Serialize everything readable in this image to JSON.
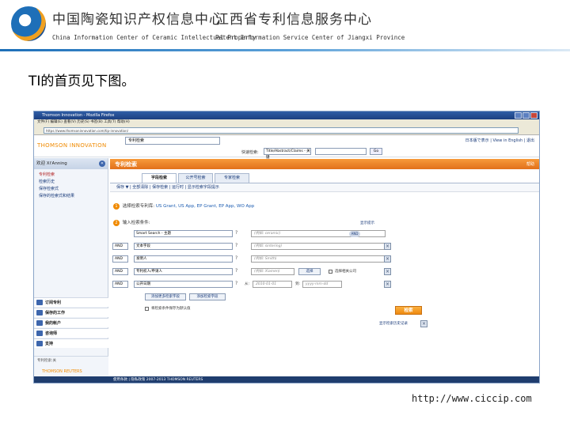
{
  "slide": {
    "header": {
      "left_cn": "中国陶瓷知识产权信息中心",
      "left_en": "China Information Center of Ceramic Intellectual Property",
      "right_cn": "江西省专利信息服务中心",
      "right_en": "Patent Information Service Center of Jiangxi Province"
    },
    "intro": "TI的首页见下图。",
    "footer_url": "http://www.ciccip.com"
  },
  "browser": {
    "title": "Thomson Innovation - Mozilla Firefox",
    "menu": "文件(F)  编辑(E)  查看(V)  历史(S)  书签(B)  工具(T)  帮助(H)",
    "address": "https://www.thomsoninnovation.com/tip-innovation/",
    "app": {
      "logo": "THOMSON INNOVATION",
      "db_select": "专利检索",
      "top_links": "日本版で表示 | View in English | 退出",
      "quick_search_label": "快速检索:",
      "quick_search_field": "Title/Abstract/Claims - 关键",
      "quick_search_go": "Go"
    },
    "sidebar": {
      "welcome": "欢迎 Xi'Anning",
      "collapse_icon": "«",
      "items": [
        {
          "label": "检索"
        },
        {
          "label": "专利检索"
        },
        {
          "label": "检索历史"
        },
        {
          "label": "保存检索式"
        },
        {
          "label": "保存的检索式和结果"
        }
      ],
      "panels": [
        {
          "label": "订阅专利"
        },
        {
          "label": "保存的工作"
        },
        {
          "label": "我的帐户"
        },
        {
          "label": "咨询师"
        },
        {
          "label": "支持"
        }
      ],
      "footer_label": "专利检索:关",
      "footer_logo": "THOMSON REUTERS"
    },
    "main": {
      "panel_title": "专利检索",
      "help": "帮助",
      "tabs": [
        {
          "label": "字段检索"
        },
        {
          "label": "公开号检索"
        },
        {
          "label": "专家检索"
        }
      ],
      "toolbar": "保存 ▼  |  全部清除  |  保存检索  |  运行时  |  显示检索字段提示",
      "step1": {
        "num": "1",
        "label": "选择检索专利库:",
        "collections": "US Grant, US App, EP Grant, EP App, WO App"
      },
      "step2": {
        "num": "2",
        "label": "输入检索条件:",
        "field_help": "显示提示"
      },
      "rows": [
        {
          "op": "",
          "field": "Smart Search - 主题",
          "placeholder": "(例如: ceramic)",
          "extra": "AND"
        },
        {
          "op": "AND",
          "field": "文本字段",
          "placeholder": "(例如: sintering)"
        },
        {
          "op": "AND",
          "field": "发明人",
          "placeholder": "(例如: Smith)"
        },
        {
          "op": "AND",
          "field": "专利权人/申请人",
          "placeholder": "(例如: Xiamen)",
          "lookup": "选择",
          "checkbox_label": "选择相关公司"
        },
        {
          "op": "AND",
          "field": "公开日期",
          "date_from": "2010-01-01",
          "date_to": "yyyy-mm-dd",
          "from_label": "从:",
          "to_label": "到:"
        }
      ],
      "add_rows": "添加更多检索字段",
      "add_fields": "添加检索字段",
      "persist_label": "将检索条件保存为默认值",
      "search_button": "检索",
      "history_link": "显示检索历史记录"
    },
    "status_bar": "使用条款 | 隐私政策 2007-2013 THOMSON REUTERS"
  }
}
